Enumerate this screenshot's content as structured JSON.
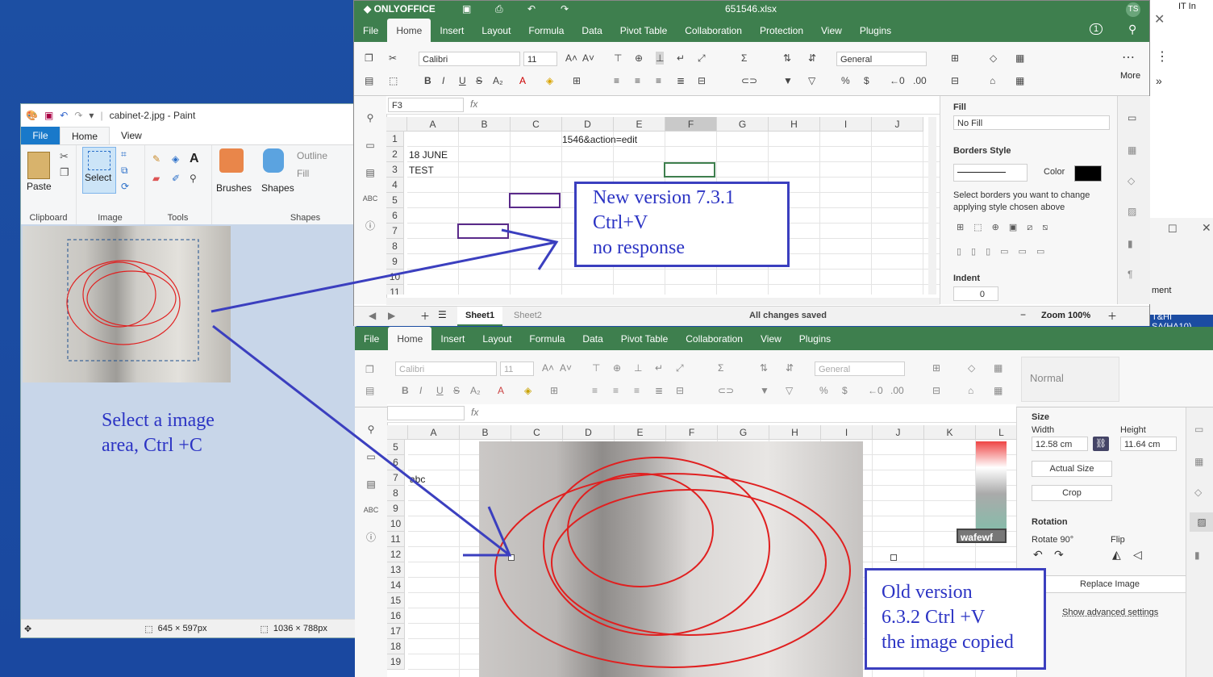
{
  "paint": {
    "title": "cabinet-2.jpg - Paint",
    "menu": {
      "file": "File",
      "home": "Home",
      "view": "View"
    },
    "tools": {
      "paste": "Paste",
      "select": "Select",
      "brushes": "Brushes",
      "shapes": "Shapes",
      "outline": "Outline",
      "fill": "Fill"
    },
    "groups": {
      "clipboard": "Clipboard",
      "image": "Image",
      "tools": "Tools",
      "shapes": "Shapes"
    },
    "status": {
      "selection": "645 × 597px",
      "size": "1036 × 788px"
    }
  },
  "desktop_note": {
    "line1": "Select a image",
    "line2": "area, Ctrl +C"
  },
  "oo_new": {
    "app": "ONLYOFFICE",
    "filename": "651546.xlsx",
    "avatar": "TS",
    "tabs": [
      "File",
      "Home",
      "Insert",
      "Layout",
      "Formula",
      "Data",
      "Pivot Table",
      "Collaboration",
      "Protection",
      "View",
      "Plugins"
    ],
    "font": "Calibri",
    "size": "11",
    "number_format": "General",
    "more": "More",
    "cell_ref": "F3",
    "fx": "fx",
    "columns": [
      "A",
      "B",
      "C",
      "D",
      "E",
      "F",
      "G",
      "H",
      "I",
      "J"
    ],
    "rows": [
      "1",
      "2",
      "3",
      "4",
      "5",
      "6",
      "7",
      "8",
      "9",
      "10",
      "11"
    ],
    "cells": {
      "d1": "1546&action=edit",
      "a2": "18 JUNE",
      "a3": "TEST"
    },
    "panel": {
      "fill_label": "Fill",
      "fill_value": "No Fill",
      "borders_label": "Borders Style",
      "color_label": "Color",
      "hint": "Select borders you want to change applying style chosen above",
      "indent_label": "Indent",
      "indent_value": "0"
    },
    "sheets": [
      "Sheet1",
      "Sheet2"
    ],
    "save_status": "All changes saved",
    "zoom": "Zoom 100%",
    "collab_count": "1"
  },
  "annot_new": {
    "line1": "New version 7.3.1",
    "line2": "Ctrl+V",
    "line3": "no response"
  },
  "oo_old": {
    "tabs": [
      "File",
      "Home",
      "Insert",
      "Layout",
      "Formula",
      "Data",
      "Pivot Table",
      "Collaboration",
      "View",
      "Plugins"
    ],
    "font": "Calibri",
    "size": "11",
    "number_format": "General",
    "style": "Normal",
    "fx": "fx",
    "columns": [
      "A",
      "B",
      "C",
      "D",
      "E",
      "F",
      "G",
      "H",
      "I",
      "J",
      "K",
      "L"
    ],
    "rows": [
      "5",
      "6",
      "7",
      "8",
      "9",
      "10",
      "11",
      "12",
      "13",
      "14",
      "15",
      "16",
      "17",
      "18",
      "19"
    ],
    "cells": {
      "a7": "abc",
      "k11": "wafewf"
    },
    "panel": {
      "size_label": "Size",
      "width_label": "Width",
      "height_label": "Height",
      "width_value": "12.58 cm",
      "height_value": "11.64 cm",
      "actual_size": "Actual Size",
      "crop": "Crop",
      "rotation_label": "Rotation",
      "rotate_label": "Rotate 90°",
      "flip_label": "Flip",
      "replace": "Replace Image",
      "advanced": "Show advanced settings"
    }
  },
  "annot_old": {
    "line1": "Old version",
    "line2": "6.3.2    Ctrl +V",
    "line3": "the image copied"
  },
  "bg_right": {
    "label1": "IT In",
    "label2": "ment",
    "label3": "T&HI SA(HA10)"
  },
  "colors": {
    "onlyoffice_green": "#3e7f4e",
    "annotation_blue": "#3b3fbf",
    "paint_blue": "#1979ca"
  }
}
